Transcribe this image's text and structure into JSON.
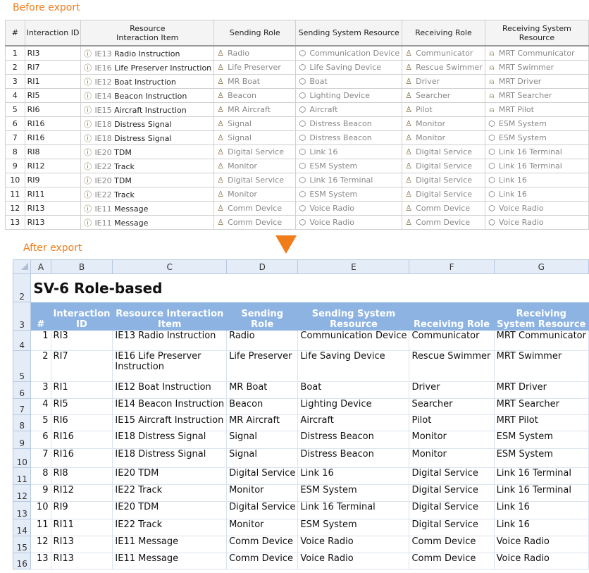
{
  "labels": {
    "before": "Before export",
    "after": "After export"
  },
  "before": {
    "headers": [
      "#",
      "Interaction ID",
      "Resource\nInteraction Item",
      "Sending Role",
      "Sending System Resource",
      "Receiving Role",
      "Receiving System Resource"
    ],
    "rows": [
      [
        "1",
        "RI3",
        "IE13",
        "Radio Instruction",
        "Radio",
        "Communication Device",
        "Communicator",
        "MRT Communicator"
      ],
      [
        "2",
        "RI7",
        "IE16",
        "Life Preserver Instruction",
        "Life Preserver",
        "Life Saving Device",
        "Rescue Swimmer",
        "MRT Swimmer"
      ],
      [
        "3",
        "RI1",
        "IE12",
        "Boat Instruction",
        "MR Boat",
        "Boat",
        "Driver",
        "MRT Driver"
      ],
      [
        "4",
        "RI5",
        "IE14",
        "Beacon Instruction",
        "Beacon",
        "Lighting Device",
        "Searcher",
        "MRT Searcher"
      ],
      [
        "5",
        "RI6",
        "IE15",
        "Aircraft Instruction",
        "MR Aircraft",
        "Aircraft",
        "Pilot",
        "MRT Pilot"
      ],
      [
        "6",
        "RI16",
        "IE18",
        "Distress Signal",
        "Signal",
        "Distress Beacon",
        "Monitor",
        "ESM System"
      ],
      [
        "7",
        "RI16",
        "IE18",
        "Distress Signal",
        "Signal",
        "Distress Beacon",
        "Monitor",
        "ESM System"
      ],
      [
        "8",
        "RI8",
        "IE20",
        "TDM",
        "Digital Service",
        "Link 16",
        "Digital Service",
        "Link 16 Terminal"
      ],
      [
        "9",
        "RI12",
        "IE22",
        "Track",
        "Monitor",
        "ESM System",
        "Digital Service",
        "Link 16 Terminal"
      ],
      [
        "10",
        "RI9",
        "IE20",
        "TDM",
        "Digital Service",
        "Link 16 Terminal",
        "Digital Service",
        "Link 16"
      ],
      [
        "11",
        "RI11",
        "IE22",
        "Track",
        "Monitor",
        "ESM System",
        "Digital Service",
        "Link 16"
      ],
      [
        "12",
        "RI13",
        "IE11",
        "Message",
        "Comm Device",
        "Voice Radio",
        "Comm Device",
        "Voice Radio"
      ],
      [
        "13",
        "RI13",
        "IE11",
        "Message",
        "Comm Device",
        "Voice Radio",
        "Comm Device",
        "Voice Radio"
      ]
    ]
  },
  "sheet": {
    "columns": [
      "A",
      "B",
      "C",
      "D",
      "E",
      "F",
      "G"
    ],
    "title_row": "2",
    "header_row": "3",
    "title": "SV-6 Role-based",
    "headers": [
      "#",
      "Interaction ID",
      "Resource Interaction Item",
      "Sending Role",
      "Sending System Resource",
      "Receiving Role",
      "Receiving System Resource"
    ],
    "rows": [
      [
        "4",
        "1",
        "RI3",
        "IE13 Radio Instruction",
        "Radio",
        "Communication Device",
        "Communicator",
        "MRT Communicator"
      ],
      [
        "5",
        "2",
        "RI7",
        "IE16 Life Preserver Instruction",
        "Life Preserver",
        "Life Saving Device",
        "Rescue Swimmer",
        "MRT Swimmer"
      ],
      [
        "6",
        "3",
        "RI1",
        "IE12 Boat Instruction",
        "MR Boat",
        "Boat",
        "Driver",
        "MRT Driver"
      ],
      [
        "7",
        "4",
        "RI5",
        "IE14 Beacon Instruction",
        "Beacon",
        "Lighting Device",
        "Searcher",
        "MRT Searcher"
      ],
      [
        "8",
        "5",
        "RI6",
        "IE15 Aircraft Instruction",
        "MR Aircraft",
        "Aircraft",
        "Pilot",
        "MRT Pilot"
      ],
      [
        "9",
        "6",
        "RI16",
        "IE18 Distress Signal",
        "Signal",
        "Distress Beacon",
        "Monitor",
        "ESM System"
      ],
      [
        "10",
        "7",
        "RI16",
        "IE18 Distress Signal",
        "Signal",
        "Distress Beacon",
        "Monitor",
        "ESM System"
      ],
      [
        "11",
        "8",
        "RI8",
        "IE20 TDM",
        "Digital Service",
        "Link 16",
        "Digital Service",
        "Link 16 Terminal"
      ],
      [
        "12",
        "9",
        "RI12",
        "IE22 Track",
        "Monitor",
        "ESM System",
        "Digital Service",
        "Link 16 Terminal"
      ],
      [
        "13",
        "10",
        "RI9",
        "IE20 TDM",
        "Digital Service",
        "Link 16 Terminal",
        "Digital Service",
        "Link 16"
      ],
      [
        "14",
        "11",
        "RI11",
        "IE22 Track",
        "Monitor",
        "ESM System",
        "Digital Service",
        "Link 16"
      ],
      [
        "15",
        "12",
        "RI13",
        "IE11 Message",
        "Comm Device",
        "Voice Radio",
        "Comm Device",
        "Voice Radio"
      ],
      [
        "16",
        "13",
        "RI13",
        "IE11 Message",
        "Comm Device",
        "Voice Radio",
        "Comm Device",
        "Voice Radio"
      ]
    ]
  },
  "colors": {
    "accent": "#f07c1a",
    "header_fill": "#8db3e2"
  }
}
